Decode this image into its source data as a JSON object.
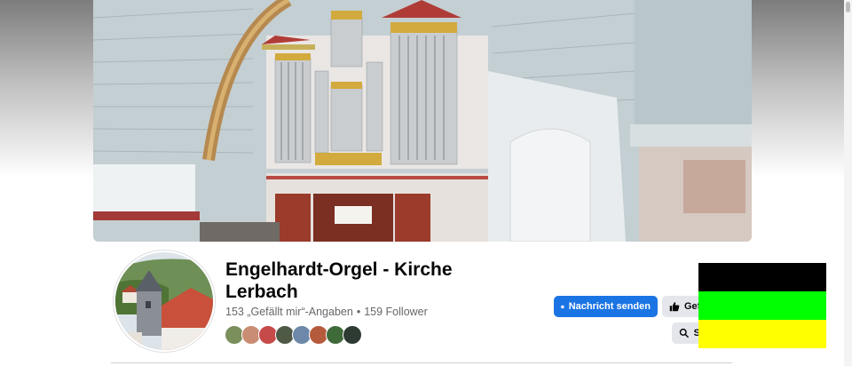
{
  "page": {
    "title": "Engelhardt-Orgel - Kirche Lerbach",
    "likes": "153 „Gefällt mir“-Angaben",
    "separator": "•",
    "followers": "159 Follower"
  },
  "actions": {
    "message_label": "Nachricht senden",
    "message_icon": "messenger-icon",
    "like_label": "Gef",
    "like_icon": "thumbs-up-icon",
    "search_label": "S",
    "search_icon": "search-icon"
  },
  "friends_count": 8,
  "flag": {
    "colors": [
      "#000000",
      "#00ff00",
      "#ffff00"
    ]
  },
  "colors": {
    "accent": "#1b74e4",
    "button_gray": "#e4e6eb",
    "text": "#050505",
    "muted": "#65676b"
  }
}
